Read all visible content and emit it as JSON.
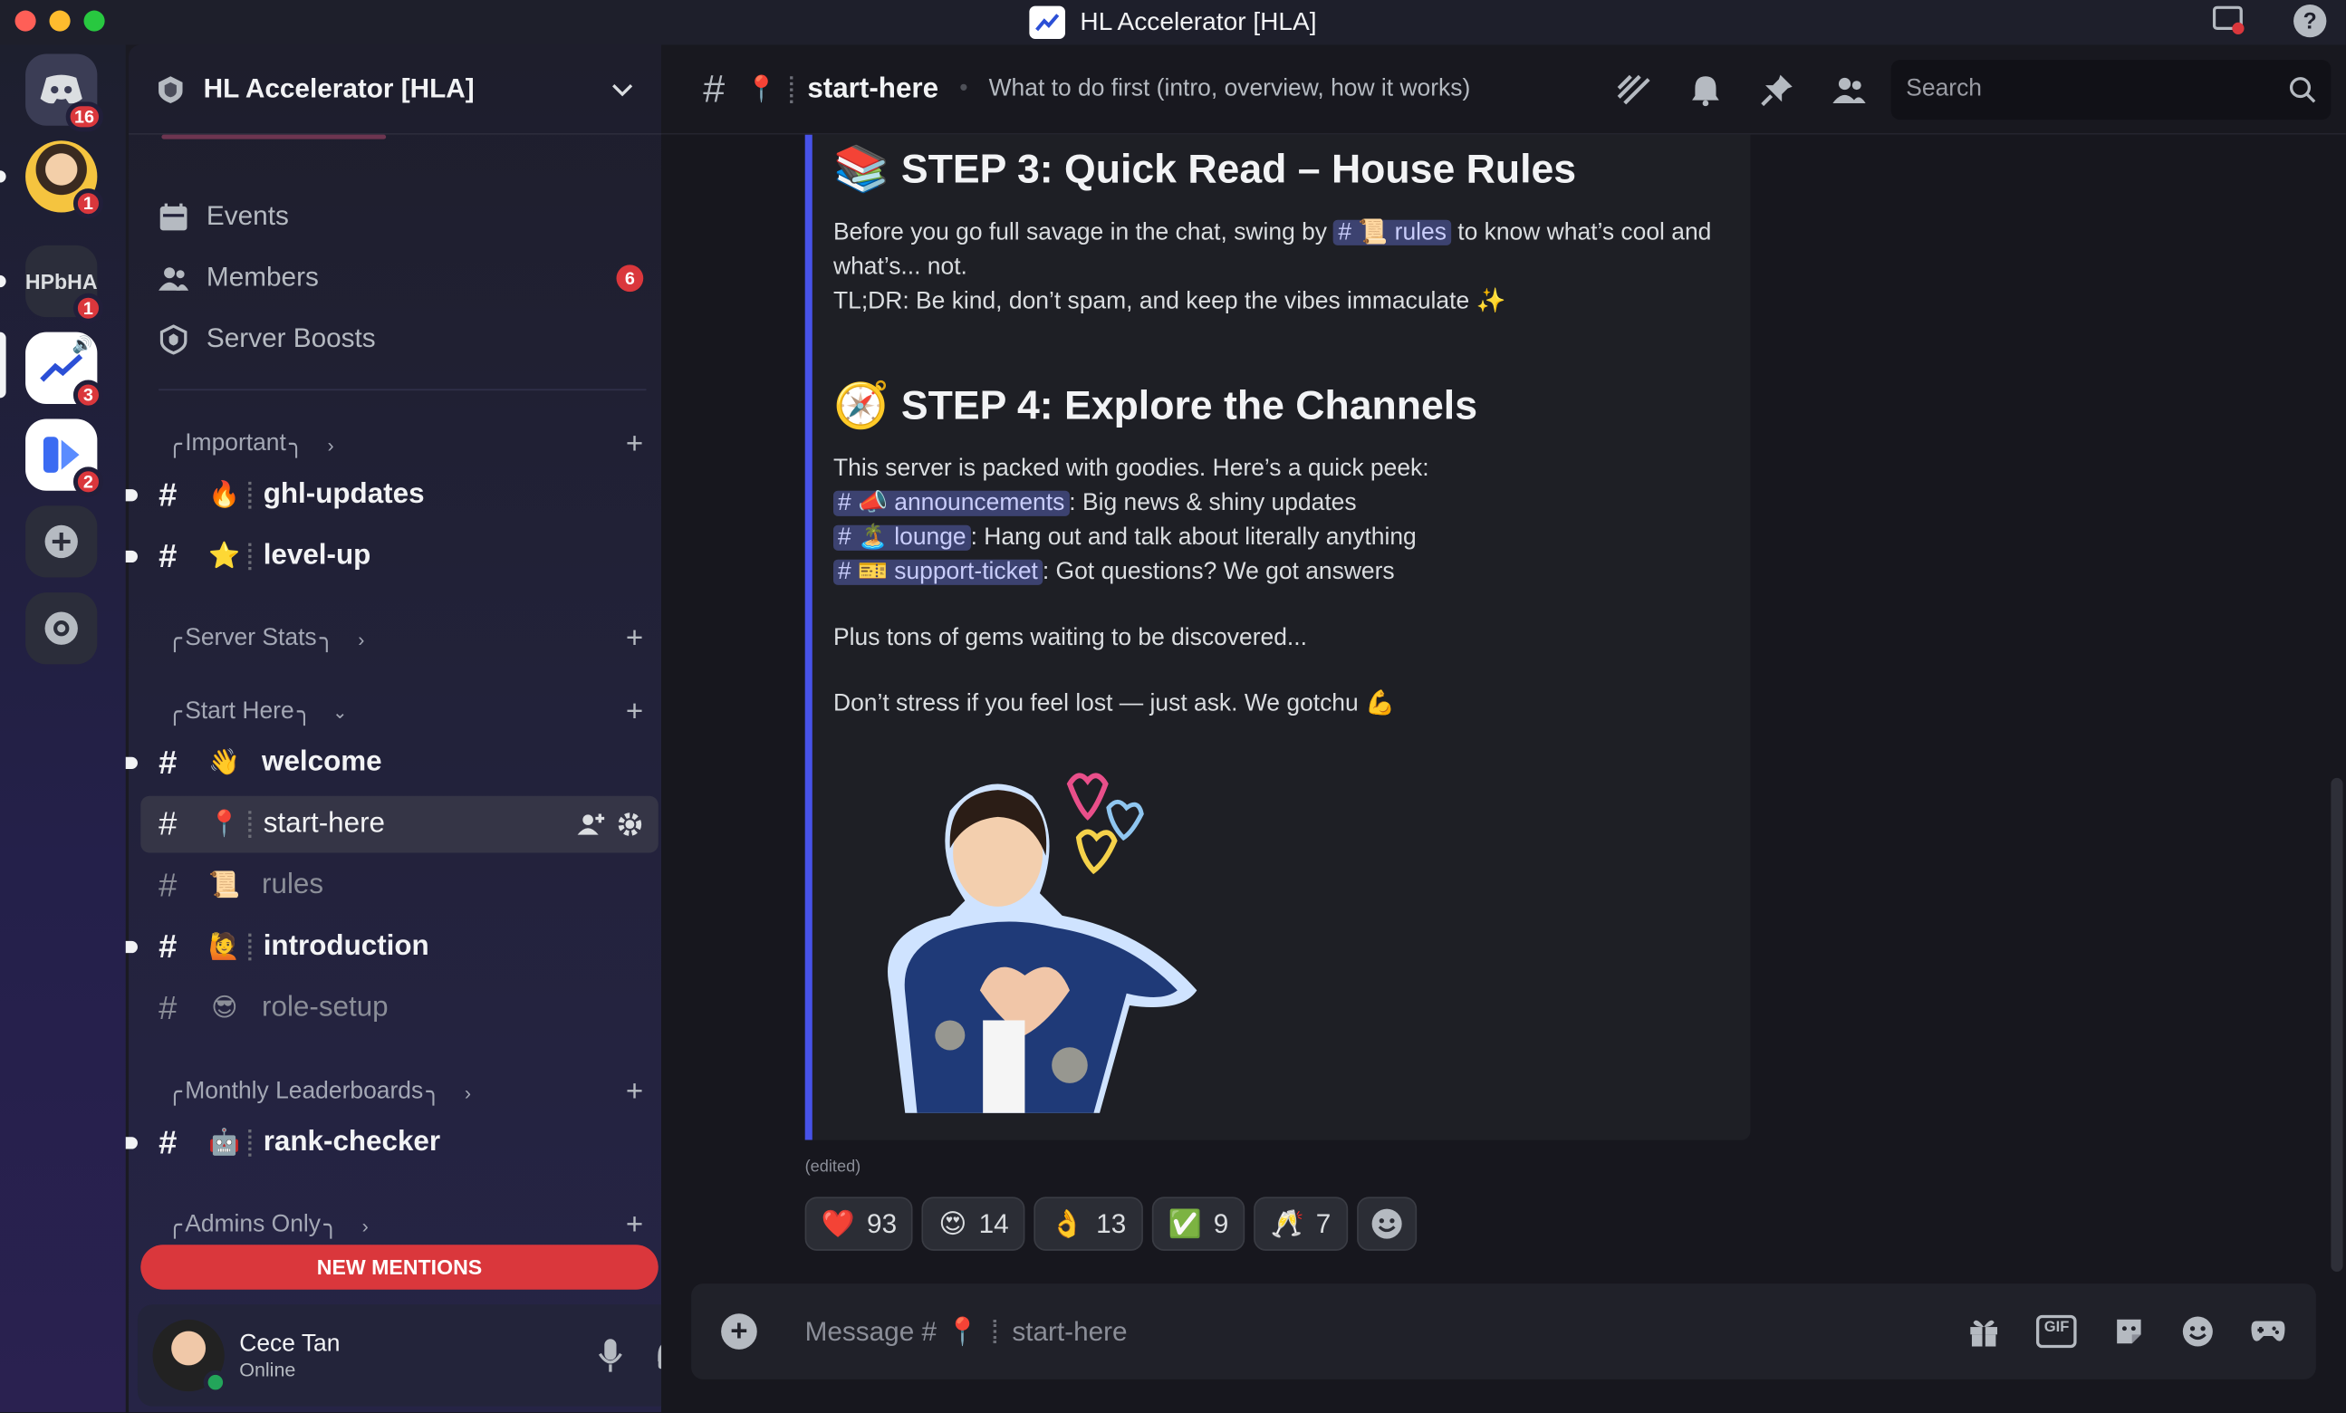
{
  "window": {
    "title": "HL Accelerator [HLA]"
  },
  "rail": {
    "dm_badge": "16",
    "servers": [
      {
        "label": "",
        "badge": "1"
      },
      {
        "label": "HPbHA",
        "badge": "1"
      },
      {
        "label": "",
        "badge": "3"
      },
      {
        "label": "",
        "badge": "2"
      }
    ]
  },
  "sidebar": {
    "guild_name": "HL Accelerator [HLA]",
    "nav": [
      {
        "label": "Events",
        "badge": ""
      },
      {
        "label": "Members",
        "badge": "6"
      },
      {
        "label": "Server Boosts",
        "badge": ""
      }
    ],
    "categories": {
      "important": "Important",
      "server_stats": "Server Stats",
      "start_here": "Start Here",
      "monthly": "Monthly Leaderboards",
      "admins": "Admins Only"
    },
    "channels": {
      "ghl_updates": {
        "name": "ghl-updates",
        "emoji": "🔥"
      },
      "level_up": {
        "name": "level-up",
        "emoji": "⭐"
      },
      "welcome": {
        "name": "welcome",
        "emoji": "👋"
      },
      "start_here": {
        "name": "start-here",
        "emoji": "📍"
      },
      "rules": {
        "name": "rules",
        "emoji": "📜"
      },
      "introduction": {
        "name": "introduction",
        "emoji": "🙋"
      },
      "role_setup": {
        "name": "role-setup",
        "emoji": "😎"
      },
      "rank_checker": {
        "name": "rank-checker",
        "emoji": "🤖"
      }
    },
    "new_mentions": "NEW MENTIONS"
  },
  "user": {
    "name": "Cece Tan",
    "status": "Online"
  },
  "header": {
    "channel_emoji": "📍",
    "channel_name": "start-here",
    "topic": "What to do first (intro, overview, how it works)",
    "search_placeholder": "Search"
  },
  "message": {
    "step3_title": "STEP 3: Quick Read – House Rules",
    "step3_text_a": "Before you go full savage in the chat, swing by",
    "step3_mention": "rules",
    "step3_text_b": "to know what’s cool and what’s... not.",
    "step3_tldr": "TL;DR: Be kind, don’t spam, and keep the vibes immaculate ✨",
    "step4_title": "STEP 4: Explore the Channels",
    "step4_intro": "This server is packed with goodies. Here’s a quick peek:",
    "links": [
      {
        "emoji": "📣",
        "name": "announcements",
        "desc": ": Big news & shiny updates"
      },
      {
        "emoji": "🏝️",
        "name": "lounge",
        "desc": ": Hang out and talk about literally anything"
      },
      {
        "emoji": "🎫",
        "name": "support-ticket",
        "desc": ": Got questions? We got answers"
      }
    ],
    "gems": "Plus tons of gems waiting to be discovered...",
    "dont_stress": "Don’t stress if you feel lost — just ask. We gotchu 💪",
    "edited": "(edited)"
  },
  "reactions": [
    {
      "emoji": "❤️",
      "count": "93"
    },
    {
      "emoji": "😍",
      "count": "14"
    },
    {
      "emoji": "👌",
      "count": "13"
    },
    {
      "emoji": "✅",
      "count": "9"
    },
    {
      "emoji": "🥂",
      "count": "7"
    }
  ],
  "composer": {
    "placeholder_prefix": "Message #",
    "emoji": "📍",
    "channel": "start-here"
  },
  "colors": {
    "accent": "#4752e8",
    "danger": "#da373c",
    "online": "#23a55a"
  }
}
